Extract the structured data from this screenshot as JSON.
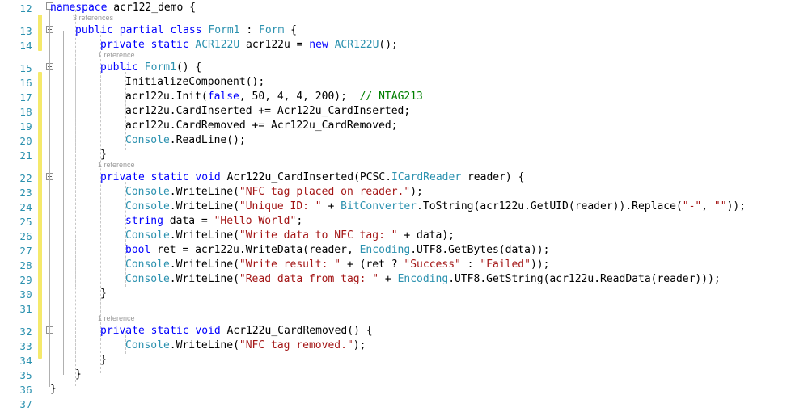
{
  "editor": {
    "language": "csharp",
    "theme": "visual-studio-light",
    "colors": {
      "background": "#ffffff",
      "line_number": "#2b91af",
      "keyword": "#0000ff",
      "type": "#2b91af",
      "string": "#a31515",
      "comment": "#008000",
      "plain": "#000000",
      "codelens": "#9a9a9a",
      "change_bar": "#f5e96b",
      "guide": "#c8c8c8"
    }
  },
  "gutter": {
    "line_numbers": [
      "12",
      "13",
      "14",
      "15",
      "16",
      "17",
      "18",
      "19",
      "20",
      "21",
      "22",
      "23",
      "24",
      "25",
      "26",
      "27",
      "28",
      "29",
      "30",
      "31",
      "32",
      "33",
      "34",
      "35",
      "36",
      "37"
    ],
    "fold_markers": [
      {
        "line": "12",
        "state": "expanded"
      },
      {
        "line": "13",
        "state": "expanded"
      },
      {
        "line": "15",
        "state": "expanded"
      },
      {
        "line": "22",
        "state": "expanded"
      },
      {
        "line": "32",
        "state": "expanded"
      }
    ],
    "change_bars": [
      {
        "from_line": "13",
        "to_line": "14"
      },
      {
        "from_line": "16",
        "to_line": "34"
      }
    ]
  },
  "codelens": [
    {
      "line": "12",
      "text": "3 references"
    },
    {
      "line": "14",
      "text": "1 reference"
    },
    {
      "line": "21",
      "text": "1 reference"
    },
    {
      "line": "31",
      "text": "1 reference"
    }
  ],
  "code": {
    "lines": [
      {
        "number": "12",
        "indent": 0,
        "tokens": [
          {
            "t": "namespace ",
            "c": "kw"
          },
          {
            "t": "acr122_demo {",
            "c": "pln"
          }
        ]
      },
      {
        "number": "13",
        "indent": 1,
        "tokens": [
          {
            "t": "public partial class ",
            "c": "kw"
          },
          {
            "t": "Form1",
            "c": "typ"
          },
          {
            "t": " : ",
            "c": "pln"
          },
          {
            "t": "Form",
            "c": "typ"
          },
          {
            "t": " {",
            "c": "pln"
          }
        ]
      },
      {
        "number": "14",
        "indent": 2,
        "tokens": [
          {
            "t": "private static ",
            "c": "kw"
          },
          {
            "t": "ACR122U",
            "c": "typ"
          },
          {
            "t": " acr122u = ",
            "c": "pln"
          },
          {
            "t": "new ",
            "c": "kw"
          },
          {
            "t": "ACR122U",
            "c": "typ"
          },
          {
            "t": "();",
            "c": "pln"
          }
        ]
      },
      {
        "number": "15",
        "indent": 2,
        "tokens": [
          {
            "t": "public ",
            "c": "kw"
          },
          {
            "t": "Form1",
            "c": "typ"
          },
          {
            "t": "() {",
            "c": "pln"
          }
        ]
      },
      {
        "number": "16",
        "indent": 3,
        "tokens": [
          {
            "t": "InitializeComponent();",
            "c": "pln"
          }
        ]
      },
      {
        "number": "17",
        "indent": 3,
        "tokens": [
          {
            "t": "acr122u.Init(",
            "c": "pln"
          },
          {
            "t": "false",
            "c": "kw"
          },
          {
            "t": ", 50, 4, 4, 200);  ",
            "c": "pln"
          },
          {
            "t": "// NTAG213",
            "c": "cmt"
          }
        ]
      },
      {
        "number": "18",
        "indent": 3,
        "tokens": [
          {
            "t": "acr122u.CardInserted += Acr122u_CardInserted;",
            "c": "pln"
          }
        ]
      },
      {
        "number": "19",
        "indent": 3,
        "tokens": [
          {
            "t": "acr122u.CardRemoved += Acr122u_CardRemoved;",
            "c": "pln"
          }
        ]
      },
      {
        "number": "20",
        "indent": 3,
        "tokens": [
          {
            "t": "Console",
            "c": "typ"
          },
          {
            "t": ".ReadLine();",
            "c": "pln"
          }
        ]
      },
      {
        "number": "21",
        "indent": 2,
        "tokens": [
          {
            "t": "}",
            "c": "pln"
          }
        ]
      },
      {
        "number": "22",
        "indent": 2,
        "tokens": [
          {
            "t": "private static void ",
            "c": "kw"
          },
          {
            "t": "Acr122u_CardInserted(PCSC.",
            "c": "pln"
          },
          {
            "t": "ICardReader",
            "c": "typ"
          },
          {
            "t": " reader) {",
            "c": "pln"
          }
        ]
      },
      {
        "number": "23",
        "indent": 3,
        "tokens": [
          {
            "t": "Console",
            "c": "typ"
          },
          {
            "t": ".WriteLine(",
            "c": "pln"
          },
          {
            "t": "\"NFC tag placed on reader.\"",
            "c": "str"
          },
          {
            "t": ");",
            "c": "pln"
          }
        ]
      },
      {
        "number": "24",
        "indent": 3,
        "tokens": [
          {
            "t": "Console",
            "c": "typ"
          },
          {
            "t": ".WriteLine(",
            "c": "pln"
          },
          {
            "t": "\"Unique ID: \"",
            "c": "str"
          },
          {
            "t": " + ",
            "c": "pln"
          },
          {
            "t": "BitConverter",
            "c": "typ"
          },
          {
            "t": ".ToString(acr122u.GetUID(reader)).Replace(",
            "c": "pln"
          },
          {
            "t": "\"-\"",
            "c": "str"
          },
          {
            "t": ", ",
            "c": "pln"
          },
          {
            "t": "\"\"",
            "c": "str"
          },
          {
            "t": "));",
            "c": "pln"
          }
        ]
      },
      {
        "number": "25",
        "indent": 3,
        "tokens": [
          {
            "t": "string ",
            "c": "kw"
          },
          {
            "t": "data = ",
            "c": "pln"
          },
          {
            "t": "\"Hello World\"",
            "c": "str"
          },
          {
            "t": ";",
            "c": "pln"
          }
        ]
      },
      {
        "number": "26",
        "indent": 3,
        "tokens": [
          {
            "t": "Console",
            "c": "typ"
          },
          {
            "t": ".WriteLine(",
            "c": "pln"
          },
          {
            "t": "\"Write data to NFC tag: \"",
            "c": "str"
          },
          {
            "t": " + data);",
            "c": "pln"
          }
        ]
      },
      {
        "number": "27",
        "indent": 3,
        "tokens": [
          {
            "t": "bool ",
            "c": "kw"
          },
          {
            "t": "ret = acr122u.WriteData(reader, ",
            "c": "pln"
          },
          {
            "t": "Encoding",
            "c": "typ"
          },
          {
            "t": ".UTF8.GetBytes(data));",
            "c": "pln"
          }
        ]
      },
      {
        "number": "28",
        "indent": 3,
        "tokens": [
          {
            "t": "Console",
            "c": "typ"
          },
          {
            "t": ".WriteLine(",
            "c": "pln"
          },
          {
            "t": "\"Write result: \"",
            "c": "str"
          },
          {
            "t": " + (ret ? ",
            "c": "pln"
          },
          {
            "t": "\"Success\"",
            "c": "str"
          },
          {
            "t": " : ",
            "c": "pln"
          },
          {
            "t": "\"Failed\"",
            "c": "str"
          },
          {
            "t": "));",
            "c": "pln"
          }
        ]
      },
      {
        "number": "29",
        "indent": 3,
        "tokens": [
          {
            "t": "Console",
            "c": "typ"
          },
          {
            "t": ".WriteLine(",
            "c": "pln"
          },
          {
            "t": "\"Read data from tag: \"",
            "c": "str"
          },
          {
            "t": " + ",
            "c": "pln"
          },
          {
            "t": "Encoding",
            "c": "typ"
          },
          {
            "t": ".UTF8.GetString(acr122u.ReadData(reader)));",
            "c": "pln"
          }
        ]
      },
      {
        "number": "30",
        "indent": 2,
        "tokens": [
          {
            "t": "}",
            "c": "pln"
          }
        ]
      },
      {
        "number": "31",
        "indent": 0,
        "tokens": []
      },
      {
        "number": "32",
        "indent": 2,
        "tokens": [
          {
            "t": "private static void ",
            "c": "kw"
          },
          {
            "t": "Acr122u_CardRemoved() {",
            "c": "pln"
          }
        ]
      },
      {
        "number": "33",
        "indent": 3,
        "tokens": [
          {
            "t": "Console",
            "c": "typ"
          },
          {
            "t": ".WriteLine(",
            "c": "pln"
          },
          {
            "t": "\"NFC tag removed.\"",
            "c": "str"
          },
          {
            "t": ");",
            "c": "pln"
          }
        ]
      },
      {
        "number": "34",
        "indent": 2,
        "tokens": [
          {
            "t": "}",
            "c": "pln"
          }
        ]
      },
      {
        "number": "35",
        "indent": 1,
        "tokens": [
          {
            "t": "}",
            "c": "pln"
          }
        ]
      },
      {
        "number": "36",
        "indent": 0,
        "tokens": [
          {
            "t": "}",
            "c": "pln"
          }
        ]
      },
      {
        "number": "37",
        "indent": 0,
        "tokens": []
      }
    ]
  }
}
